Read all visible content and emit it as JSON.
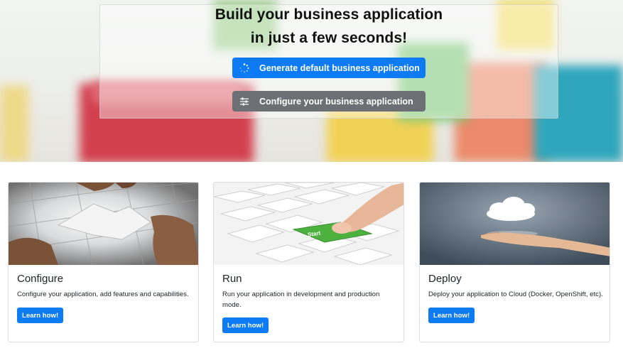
{
  "hero": {
    "title_line1": "Build your business application",
    "title_line2": "in just a few seconds!",
    "generate_button": {
      "label": "Generate default business application",
      "icon": "spinner-icon"
    },
    "configure_button": {
      "label": "Configure your business application",
      "icon": "sliders-icon"
    }
  },
  "cards": [
    {
      "title": "Configure",
      "text": "Configure your application, add features and capabilities.",
      "button": "Learn how!",
      "image": "puzzle-image"
    },
    {
      "title": "Run",
      "text": "Run your application in development and production mode.",
      "button": "Learn how!",
      "image": "keyboard-start-image",
      "image_label": "Start"
    },
    {
      "title": "Deploy",
      "text": "Deploy your application to Cloud (Docker, OpenShift, etc).",
      "button": "Learn how!",
      "image": "cloud-hand-image"
    }
  ],
  "colors": {
    "primary": "#0d7bf4",
    "secondary": "#6c6f73",
    "key_green": "#4cb13e"
  }
}
